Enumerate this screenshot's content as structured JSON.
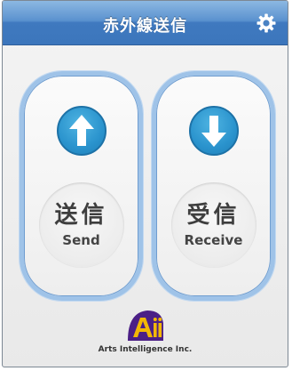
{
  "header": {
    "title": "赤外線送信",
    "settings_icon": "gear-icon"
  },
  "buttons": {
    "send": {
      "label_jp": "送信",
      "label_en": "Send",
      "icon": "arrow-up-icon"
    },
    "receive": {
      "label_jp": "受信",
      "label_en": "Receive",
      "icon": "arrow-down-icon"
    }
  },
  "footer": {
    "logo_text": "Arts Intelligence Inc."
  },
  "colors": {
    "titlebar": "#3f79bf",
    "panel_border": "#9fc3e8",
    "arrow_circle": "#2a93cd",
    "logo_purple": "#4b1f86",
    "logo_gold": "#f2b705"
  }
}
